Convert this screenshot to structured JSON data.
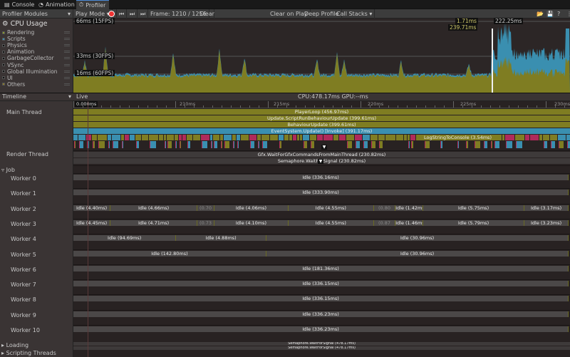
{
  "tabs": [
    {
      "label": "Console",
      "icon": "console-icon"
    },
    {
      "label": "Animation",
      "icon": "animation-icon"
    },
    {
      "label": "Profiler",
      "icon": "profiler-icon",
      "active": true
    }
  ],
  "toolbar": {
    "modules": "Profiler Modules",
    "play_mode": "Play Mode",
    "frame": "Frame: 1210 / 1256",
    "clear": "Clear",
    "clear_on_play": "Clear on Play",
    "deep_profile": "Deep Profile",
    "call_stacks": "Call Stacks"
  },
  "cpu": {
    "title": "CPU Usage",
    "legend": [
      {
        "label": "Rendering",
        "color": "#8c9a2a"
      },
      {
        "label": "Scripts",
        "color": "#3a8fb0"
      },
      {
        "label": "Physics",
        "color": "#111111"
      },
      {
        "label": "Animation",
        "color": "#111111"
      },
      {
        "label": "GarbageCollector",
        "color": "#111111"
      },
      {
        "label": "VSync",
        "color": "#111111"
      },
      {
        "label": "Global Illumination",
        "color": "#111111"
      },
      {
        "label": "UI",
        "color": "#111111"
      },
      {
        "label": "Others",
        "color": "#8c7a2a"
      }
    ],
    "fps_lines": [
      "66ms (15FPS)",
      "33ms (30FPS)",
      "16ms (60FPS)"
    ],
    "selected": {
      "v1": "1.71ms",
      "v2": "222.25ms",
      "v3": "239.71ms"
    }
  },
  "timeline": {
    "mode": "Timeline",
    "live": "Live",
    "cpu_gpu": "CPU:478.17ms  GPU:--ms",
    "ruler": [
      "0.000ms",
      "210ms",
      "215ms",
      "220ms",
      "225ms",
      "230ms"
    ],
    "threads": {
      "main": "Main Thread",
      "render": "Render Thread",
      "job": "Job",
      "loading": "Loading",
      "scripting": "Scripting Threads"
    },
    "main_bars": [
      "PlayerLoop (456.97ms)",
      "Update.ScriptRunBehaviourUpdate (399.61ms)",
      "BehaviourUpdate (399.61ms)",
      "EventSystem.Update() [Invoke] (391.17ms)"
    ],
    "log_bar": "LogStringToConsole (3.54ms)",
    "render_bars": [
      "Gfx.WaitForGfxCommandsFromMainThread (230.82ms)",
      "Semaphore.WaitForSignal (230.82ms)"
    ],
    "loading_bars": [
      "Semaphore.WaitForSignal (478.17ms)",
      "Semaphore.WaitForSignal (478.17ms)"
    ],
    "workers": [
      {
        "name": "Worker 0",
        "segs": [
          {
            "l": "Idle (336.16ms)",
            "s": 204.41,
            "e": 230.84
          }
        ]
      },
      {
        "name": "Worker 1",
        "segs": [
          {
            "l": "Idle (333.90ms)",
            "s": 204.41,
            "e": 230.84
          }
        ]
      },
      {
        "name": "Worker 2",
        "segs": [
          {
            "l": "Idle (4.40ms)",
            "s": 204.41,
            "e": 206.39
          },
          {
            "l": "Idle (4.66ms)",
            "s": 206.39,
            "e": 211.03
          },
          {
            "l": "(0.70",
            "s": 211.03,
            "e": 211.94
          },
          {
            "l": "Idle (4.06ms)",
            "s": 211.94,
            "e": 215.89
          },
          {
            "l": "Idle (4.55ms)",
            "s": 215.89,
            "e": 220.45
          },
          {
            "l": "(0.80",
            "s": 220.45,
            "e": 221.6
          },
          {
            "l": "Idle (1.42ms)",
            "s": 221.6,
            "e": 223.08
          },
          {
            "l": "Idle (5.75ms)",
            "s": 223.08,
            "e": 228.48
          },
          {
            "l": "Idle (3.17ms)",
            "s": 228.48,
            "e": 230.84
          }
        ]
      },
      {
        "name": "Worker 3",
        "segs": [
          {
            "l": "Idle (4.45ms)",
            "s": 204.41,
            "e": 206.39
          },
          {
            "l": "Idle (4.71ms)",
            "s": 206.39,
            "e": 211.03
          },
          {
            "l": "(0.73",
            "s": 211.03,
            "e": 211.94
          },
          {
            "l": "Idle (4.10ms)",
            "s": 211.94,
            "e": 215.89
          },
          {
            "l": "Idle (4.55ms)",
            "s": 215.89,
            "e": 220.45
          },
          {
            "l": "(0.87",
            "s": 220.45,
            "e": 221.6
          },
          {
            "l": "Idle (1.46ms)",
            "s": 221.6,
            "e": 223.08
          },
          {
            "l": "Idle (5.79ms)",
            "s": 223.08,
            "e": 228.48
          },
          {
            "l": "Idle (3.23ms)",
            "s": 228.48,
            "e": 230.84
          }
        ]
      },
      {
        "name": "Worker 4",
        "segs": [
          {
            "l": "Idle (94.69ms)",
            "s": 204.41,
            "e": 209.9
          },
          {
            "l": "Idle (4.88ms)",
            "s": 209.9,
            "e": 214.71
          },
          {
            "l": "Idle (30.96ms)",
            "s": 214.71,
            "e": 230.84
          }
        ]
      },
      {
        "name": "Worker 5",
        "segs": [
          {
            "l": "Idle (142.80ms)",
            "s": 204.41,
            "e": 214.71
          },
          {
            "l": "Idle (30.96ms)",
            "s": 214.71,
            "e": 230.84
          }
        ]
      },
      {
        "name": "Worker 6",
        "segs": [
          {
            "l": "Idle (181.36ms)",
            "s": 204.41,
            "e": 230.84
          }
        ]
      },
      {
        "name": "Worker 7",
        "segs": [
          {
            "l": "Idle (336.15ms)",
            "s": 204.41,
            "e": 230.84
          }
        ]
      },
      {
        "name": "Worker 8",
        "segs": [
          {
            "l": "Idle (336.15ms)",
            "s": 204.41,
            "e": 230.84
          }
        ]
      },
      {
        "name": "Worker 9",
        "segs": [
          {
            "l": "Idle (336.23ms)",
            "s": 204.41,
            "e": 230.84
          }
        ]
      },
      {
        "name": "Worker 10",
        "segs": [
          {
            "l": "Idle (336.23ms)",
            "s": 204.41,
            "e": 230.84
          }
        ]
      }
    ]
  }
}
